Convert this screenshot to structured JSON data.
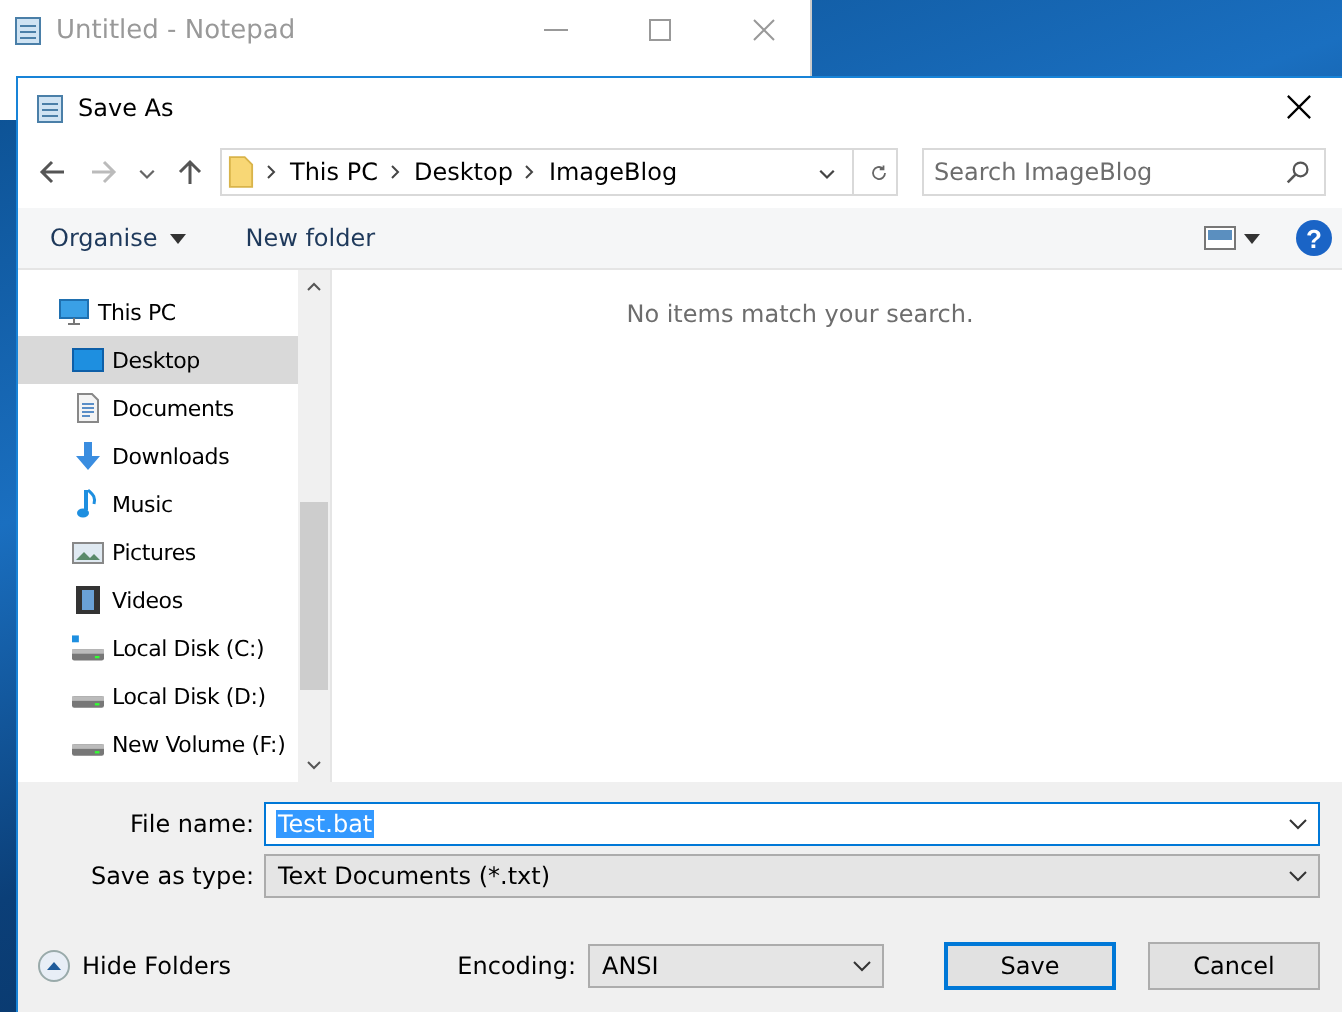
{
  "background_window": {
    "title": "Untitled - Notepad"
  },
  "dialog": {
    "title": "Save As",
    "breadcrumb": [
      "This PC",
      "Desktop",
      "ImageBlog"
    ],
    "search": {
      "placeholder": "Search ImageBlog"
    },
    "toolbar": {
      "organise": "Organise",
      "new_folder": "New folder",
      "help": "?"
    },
    "tree": [
      {
        "label": "This PC",
        "kind": "pc",
        "selected": false,
        "children": [
          {
            "label": "Desktop",
            "kind": "desktop",
            "selected": true
          },
          {
            "label": "Documents",
            "kind": "documents",
            "selected": false
          },
          {
            "label": "Downloads",
            "kind": "downloads",
            "selected": false
          },
          {
            "label": "Music",
            "kind": "music",
            "selected": false
          },
          {
            "label": "Pictures",
            "kind": "pictures",
            "selected": false
          },
          {
            "label": "Videos",
            "kind": "videos",
            "selected": false
          },
          {
            "label": "Local Disk (C:)",
            "kind": "system-drive",
            "selected": false
          },
          {
            "label": "Local Disk (D:)",
            "kind": "drive",
            "selected": false
          },
          {
            "label": "New Volume (F:)",
            "kind": "drive",
            "selected": false
          }
        ]
      }
    ],
    "empty_message": "No items match your search.",
    "file_name": {
      "label": "File name:",
      "value": "Test.bat",
      "value_selected": true
    },
    "save_as_type": {
      "label": "Save as type:",
      "value": "Text Documents (*.txt)"
    },
    "hide_folders": "Hide Folders",
    "encoding": {
      "label": "Encoding:",
      "value": "ANSI"
    },
    "buttons": [
      {
        "label": "Save",
        "default": true
      },
      {
        "label": "Cancel",
        "default": false
      }
    ]
  }
}
